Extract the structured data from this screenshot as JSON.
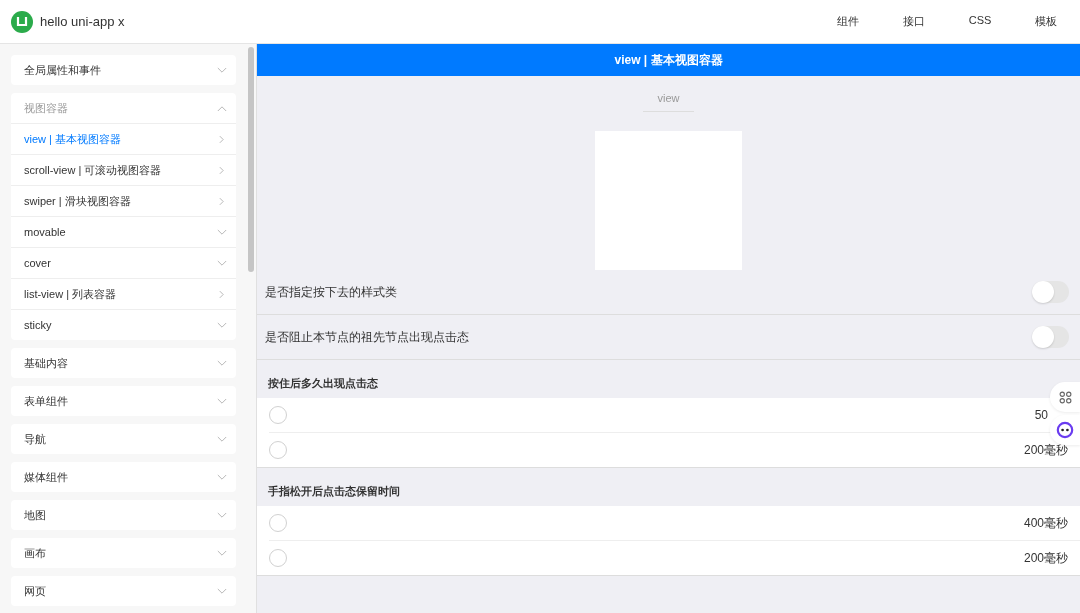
{
  "header": {
    "title": "hello uni-app x",
    "nav": [
      {
        "label": "组件",
        "selected": false
      },
      {
        "label": "接口",
        "selected": false
      },
      {
        "label": "CSS",
        "selected": false
      },
      {
        "label": "模板",
        "selected": false
      }
    ]
  },
  "sidebar": {
    "groups": [
      {
        "label": "全局属性和事件",
        "expanded": false
      },
      {
        "label": "视图容器",
        "expanded": true,
        "children": [
          {
            "label": "view | 基本视图容器",
            "kind": "page",
            "selected": true
          },
          {
            "label": "scroll-view | 可滚动视图容器",
            "kind": "page",
            "selected": false
          },
          {
            "label": "swiper | 滑块视图容器",
            "kind": "page",
            "selected": false
          },
          {
            "label": "movable",
            "kind": "group",
            "selected": false
          },
          {
            "label": "cover",
            "kind": "group",
            "selected": false
          },
          {
            "label": "list-view | 列表容器",
            "kind": "page",
            "selected": false
          },
          {
            "label": "sticky",
            "kind": "group",
            "selected": false
          }
        ]
      },
      {
        "label": "基础内容",
        "expanded": false
      },
      {
        "label": "表单组件",
        "expanded": false
      },
      {
        "label": "导航",
        "expanded": false
      },
      {
        "label": "媒体组件",
        "expanded": false
      },
      {
        "label": "地图",
        "expanded": false
      },
      {
        "label": "画布",
        "expanded": false
      },
      {
        "label": "网页",
        "expanded": false
      }
    ]
  },
  "page": {
    "title": "view | 基本视图容器",
    "demo_label": "view",
    "toggles": [
      {
        "label": "是否指定按下去的样式类",
        "on": false
      },
      {
        "label": "是否阻止本节点的祖先节点出现点击态",
        "on": false
      }
    ],
    "radio_groups": [
      {
        "title": "按住后多久出现点击态",
        "options": [
          {
            "value": "50",
            "checked": false
          },
          {
            "value": "200毫秒",
            "checked": false
          }
        ]
      },
      {
        "title": "手指松开后点击态保留时间",
        "options": [
          {
            "value": "400毫秒",
            "checked": false
          },
          {
            "value": "200毫秒",
            "checked": false
          }
        ]
      }
    ]
  }
}
